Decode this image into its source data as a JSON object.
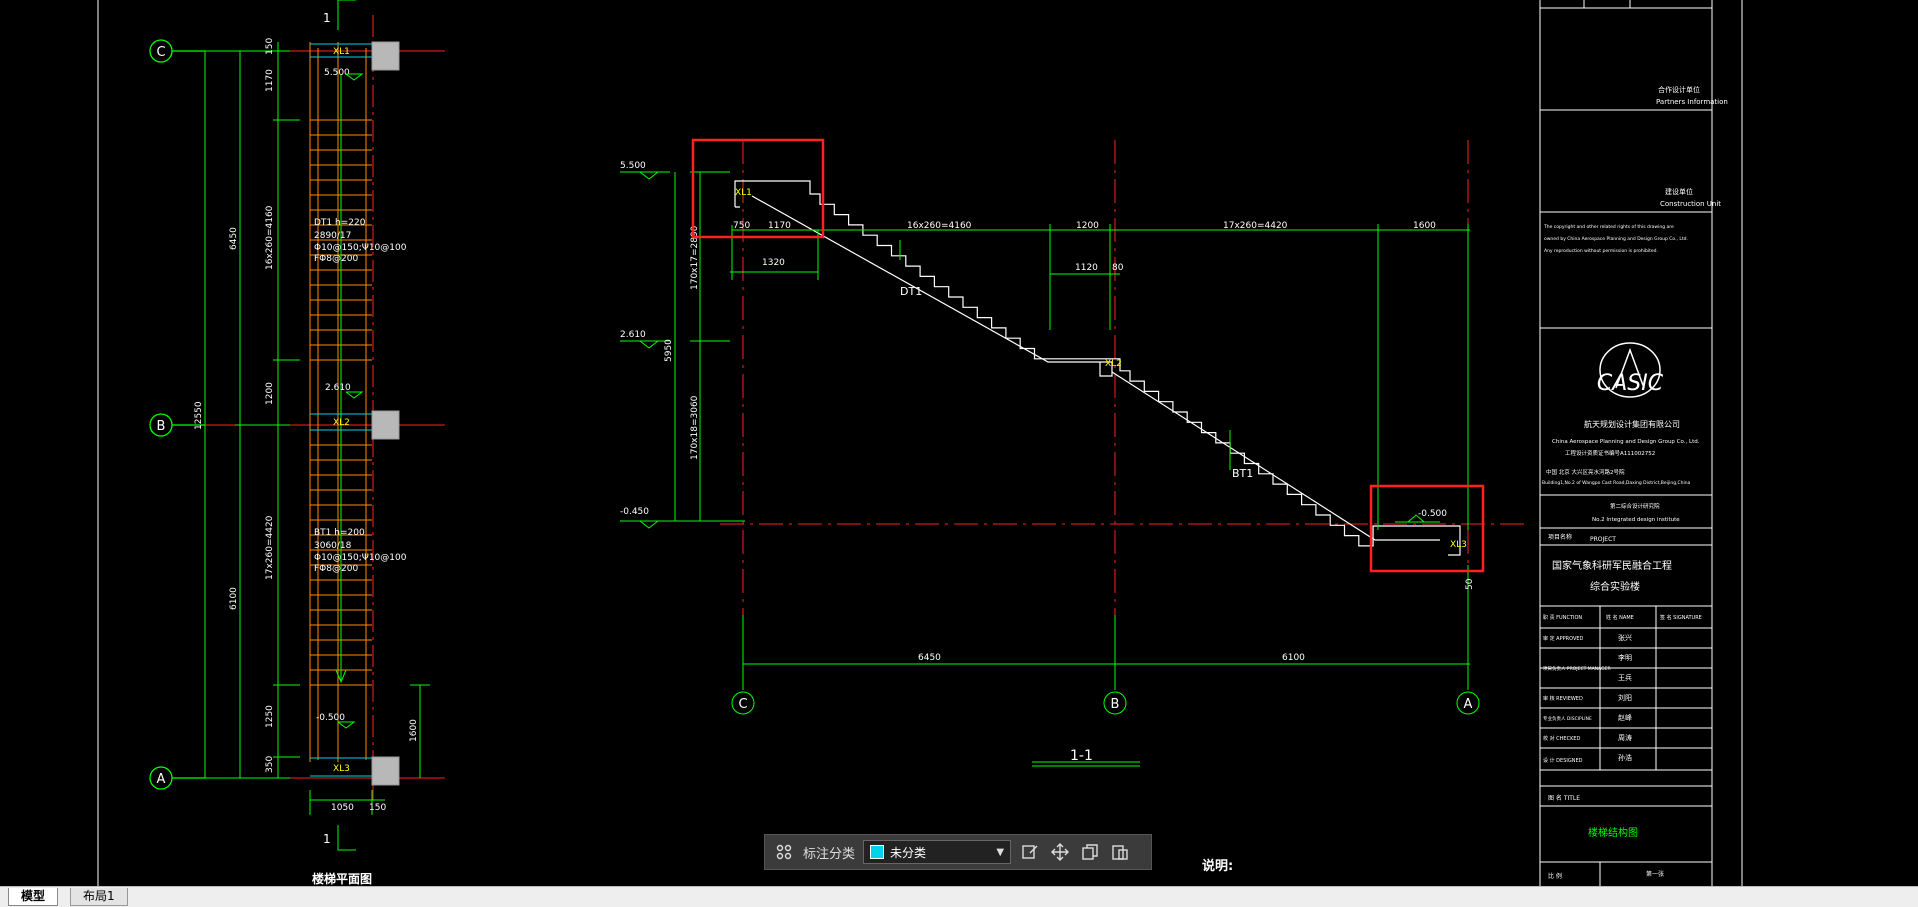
{
  "plan": {
    "axis_c": "C",
    "axis_b": "B",
    "axis_a": "A",
    "section_mark_top": "1",
    "section_mark_bottom": "1",
    "xl1": "XL1",
    "xl2": "XL2",
    "xl3": "XL3",
    "elev_top": "5.500",
    "elev_mid": "2.610",
    "elev_bot": "-0.500",
    "dim_150": "150",
    "dim_1170": "1170",
    "dim_16x260": "16x260=4160",
    "dim_1200": "1200",
    "dim_17x260": "17x260=4420",
    "dim_1250": "1250",
    "dim_350": "350",
    "dim_6450": "6450",
    "dim_6100": "6100",
    "dim_12550": "12550",
    "dim_1600": "1600",
    "dim_1050": "1050",
    "dim_150b": "150",
    "dt1_title": "DT1  h=220",
    "dt1_l1": "2890/17",
    "dt1_l2": "Φ10@150;Ψ10@100",
    "dt1_l3": "FΦ8@200",
    "bt1_title": "BT1  h=200",
    "bt1_l1": "3060/18",
    "bt1_l2": "Φ10@150;Ψ10@100",
    "bt1_l3": "FΦ8@200",
    "plan_title": "楼梯平面图"
  },
  "section": {
    "elev_top": "5.500",
    "elev_mid": "2.610",
    "elev_bot": "-0.450",
    "elev_right": "-0.500",
    "xl1": "XL1",
    "xl2": "XL2",
    "xl3": "XL3",
    "dim_750": "750",
    "dim_1170": "1170",
    "dim_1320": "1320",
    "dim_16x260": "16x260=4160",
    "dim_1200": "1200",
    "dim_17x260": "17x260=4420",
    "dim_1600": "1600",
    "dim_1120": "1120",
    "dim_80": "80",
    "dim_v_upper": "170x17=2890",
    "dim_v_lower": "170x18=3060",
    "dim_v_total": "5950",
    "dim_50": "50",
    "dim_6450": "6450",
    "dim_6100": "6100",
    "dt1": "DT1",
    "bt1": "BT1",
    "axis_c": "C",
    "axis_b": "B",
    "axis_a": "A",
    "title": "1-1",
    "notes": "说明:"
  },
  "titleblock": {
    "partners_cn": "合作设计单位",
    "partners_en": "Partners Information",
    "construction_cn": "建设单位",
    "construction_en": "Construction Unit",
    "copyright_1": "The copyright and other related rights of this drawing are",
    "copyright_2": "owned by China Aerospace Planning and Design Group Co., Ltd.",
    "copyright_3": "Any reproduction without permission is prohibited.",
    "logo": "CASIC",
    "company_cn": "航天规划设计集团有限公司",
    "company_en": "China Aerospace Planning and Design Group Co., Ltd.",
    "cert": "工程设计资质证书编号A111002752",
    "address_cn": "中国 北京 大兴区亮水河路2号院",
    "address_en": "Building1,No.2 of Wangpo Cast Road,Daxing District,Beijing,China",
    "institute_cn": "第二综合设计研究院",
    "institute_en": "No.2 Integrated design institute",
    "project_label_cn": "项目名称",
    "project_label_en": "PROJECT",
    "project_name_1": "国家气象科研军民融合工程",
    "project_name_2": "综合实验楼",
    "col_function": "职 责 FUNCTION",
    "col_name": "姓 名 NAME",
    "col_signature": "签 名 SIGNATURE",
    "row_approved": "审 定 APPROVED",
    "row_manager": "项目负责人 PROJECT MANAGER",
    "row_reviewed": "审 核 REVIEWED",
    "row_discipline": "专业负责人 DISCIPLINE",
    "row_checked": "校 对 CHECKED",
    "row_designed": "设 计 DESIGNED",
    "name_1": "张兴",
    "name_2": "李明",
    "name_3": "王兵",
    "name_4": "刘阳",
    "name_5": "赵峰",
    "name_6": "周涛",
    "name_7": "孙浩",
    "title_label": "图 名 TITLE",
    "drawing_title": "楼梯结构图",
    "scale_label": "比 例",
    "sheet_no": "第一张"
  },
  "toolbar": {
    "grid_icon": "grid-icon",
    "category_label": "标注分类",
    "category_value": "未分类",
    "swatch_color": "#00d4e8",
    "edit_icon": "edit-icon",
    "move_icon": "move-icon",
    "copy_icon": "copy-icon",
    "paste_icon": "paste-icon"
  },
  "tabs": {
    "model": "模型",
    "layout1": "布局1"
  },
  "colors": {
    "background": "#000000",
    "dimension": "#00ff00",
    "axis": "#ff0000",
    "stair": "#ff8c00",
    "highlight": "#ff2020",
    "label": "#ffff00"
  }
}
